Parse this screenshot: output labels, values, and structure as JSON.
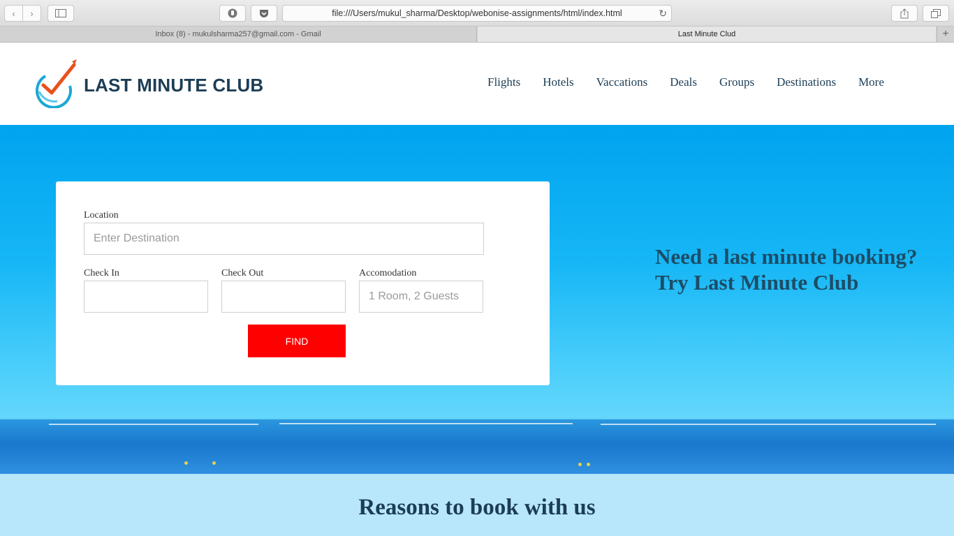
{
  "browser": {
    "url": "file:///Users/mukul_sharma/Desktop/webonise-assignments/html/index.html",
    "tabs": [
      {
        "label": "Inbox (8) - mukulsharma257@gmail.com - Gmail"
      },
      {
        "label": "Last Minute Clud"
      }
    ]
  },
  "header": {
    "brand": "LAST MINUTE CLUB",
    "nav": [
      "Flights",
      "Hotels",
      "Vaccations",
      "Deals",
      "Groups",
      "Destinations",
      "More"
    ]
  },
  "search": {
    "location_label": "Location",
    "location_placeholder": "Enter Destination",
    "checkin_label": "Check In",
    "checkout_label": "Check Out",
    "accomodation_label": "Accomodation",
    "accomodation_placeholder": "1 Room, 2 Guests",
    "find_label": "FIND"
  },
  "hero": {
    "tagline_line1": "Need a last minute booking?",
    "tagline_line2": "Try Last Minute Club"
  },
  "reasons": {
    "title": "Reasons to book with us"
  },
  "colors": {
    "brand_navy": "#1c3d55",
    "find_button": "#ff0000",
    "hero_sky": "#00a4ef",
    "reasons_bg": "#b8e7fb"
  }
}
